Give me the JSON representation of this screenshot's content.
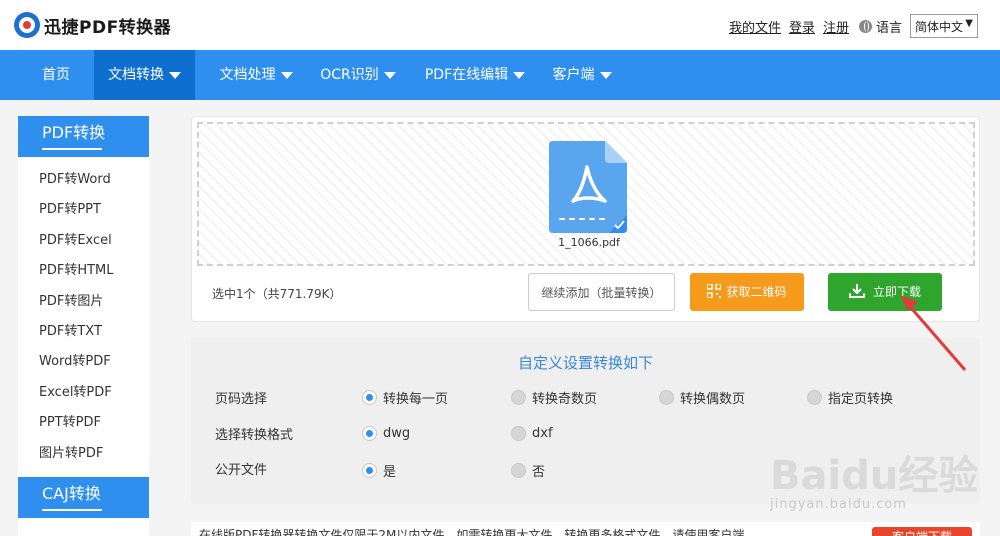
{
  "app": {
    "logo_text": "迅捷PDF转换器"
  },
  "toplinks": {
    "my_files": "我的文件",
    "login": "登录",
    "register": "注册",
    "language_label": "语言",
    "language_value": "简体中文"
  },
  "nav": {
    "items": [
      {
        "label": "首页",
        "has_caret": false
      },
      {
        "label": "文档转换",
        "has_caret": true,
        "active": true
      },
      {
        "label": "文档处理",
        "has_caret": true
      },
      {
        "label": "OCR识别",
        "has_caret": true
      },
      {
        "label": "PDF在线编辑",
        "has_caret": true
      },
      {
        "label": "客户端",
        "has_caret": true
      }
    ]
  },
  "sidebar": {
    "section1_title": "PDF转换",
    "items": [
      "PDF转Word",
      "PDF转PPT",
      "PDF转Excel",
      "PDF转HTML",
      "PDF转图片",
      "PDF转TXT",
      "Word转PDF",
      "Excel转PDF",
      "PPT转PDF",
      "图片转PDF"
    ],
    "section2_title": "CAJ转换"
  },
  "upload": {
    "file_name": "1_1066.pdf",
    "selected_text": "选中1个（共771.79K）",
    "add_button": "继续添加（批量转换）",
    "qr_button": "获取二维码",
    "download_button": "立即下载"
  },
  "settings": {
    "title": "自定义设置转换如下",
    "rows": [
      {
        "label": "页码选择",
        "options": [
          {
            "label": "转换每一页",
            "selected": true
          },
          {
            "label": "转换奇数页",
            "selected": false
          },
          {
            "label": "转换偶数页",
            "selected": false
          },
          {
            "label": "指定页转换",
            "selected": false
          }
        ]
      },
      {
        "label": "选择转换格式",
        "options": [
          {
            "label": "dwg",
            "selected": true
          },
          {
            "label": "dxf",
            "selected": false
          }
        ]
      },
      {
        "label": "公开文件",
        "options": [
          {
            "label": "是",
            "selected": true
          },
          {
            "label": "否",
            "selected": false
          }
        ]
      }
    ]
  },
  "bottom": {
    "notice": "在线版PDF转换器转换文件仅限于2M以内文件，如需转换更大文件、转换更多格式文件，请使用客户端",
    "button": "客户端下载"
  },
  "watermark": {
    "brand": "Baidu经验",
    "url": "jingyan.baidu.com"
  },
  "colors": {
    "nav_blue": "#2e8fef",
    "nav_active": "#0f6fd0",
    "orange": "#f59a1b",
    "green": "#2fa52e",
    "file_blue": "#5aa6ee",
    "annotation_red": "#e33a3a"
  }
}
